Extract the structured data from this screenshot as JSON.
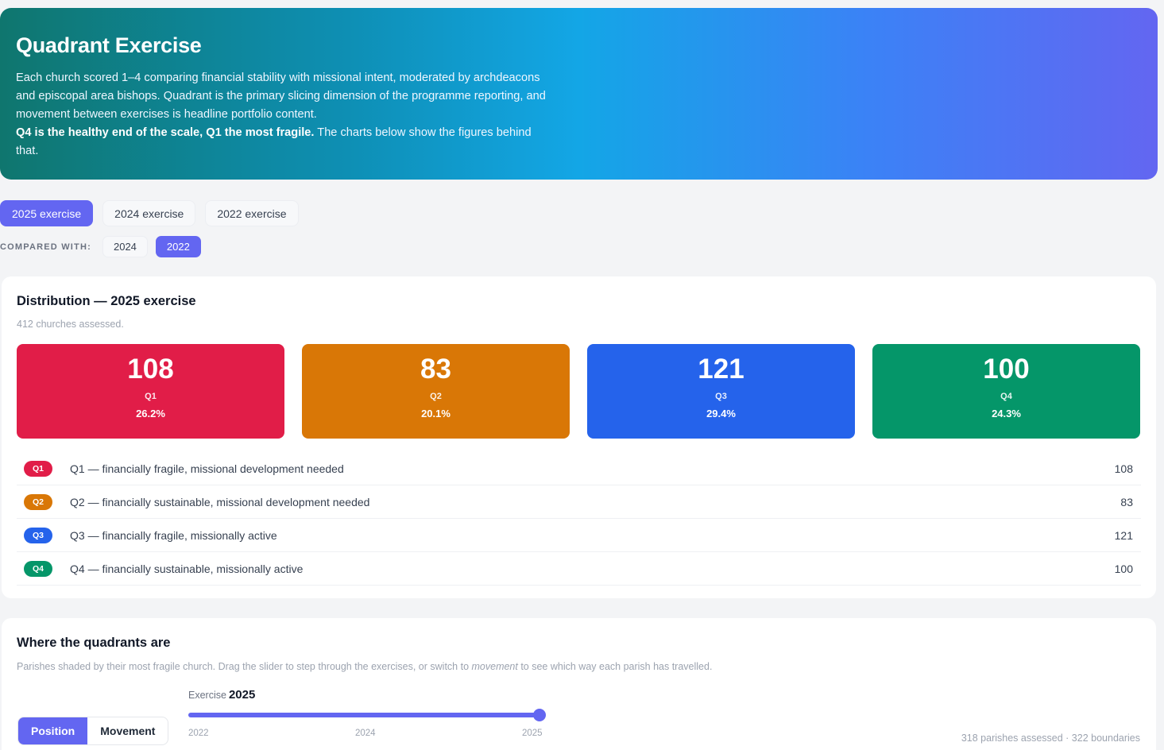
{
  "hero": {
    "title": "Quadrant Exercise",
    "text": "Each church scored 1–4 comparing financial stability with missional intent, moderated by archdeacons and episcopal area bishops. Quadrant is the primary slicing dimension of the programme reporting, and movement between exercises is headline portfolio content.",
    "bold": "Q4 is the healthy end of the scale, Q1 the most fragile.",
    "tail": " The charts below show the figures behind that."
  },
  "tabs": [
    "2025 exercise",
    "2024 exercise",
    "2022 exercise"
  ],
  "compare": {
    "label": "COMPARED WITH:",
    "options": [
      "2024",
      "2022"
    ]
  },
  "distribution": {
    "title": "Distribution — 2025 exercise",
    "subtitle": "412 churches assessed.",
    "tiles": [
      {
        "num": "108",
        "q": "Q1",
        "pct": "26.2%",
        "color": "#e11d48"
      },
      {
        "num": "83",
        "q": "Q2",
        "pct": "20.1%",
        "color": "#d97706"
      },
      {
        "num": "121",
        "q": "Q3",
        "pct": "29.4%",
        "color": "#2563eb"
      },
      {
        "num": "100",
        "q": "Q4",
        "pct": "24.3%",
        "color": "#059669"
      }
    ],
    "legend": [
      {
        "badge": "Q1",
        "label": "Q1 — financially fragile, missional development needed",
        "count": "108"
      },
      {
        "badge": "Q2",
        "label": "Q2 — financially sustainable, missional development needed",
        "count": "83"
      },
      {
        "badge": "Q3",
        "label": "Q3 — financially fragile, missionally active",
        "count": "121"
      },
      {
        "badge": "Q4",
        "label": "Q4 — financially sustainable, missionally active",
        "count": "100"
      }
    ]
  },
  "map": {
    "title": "Where the quadrants are",
    "sub_a": "Parishes shaded by their most fragile church. Drag the slider to step through the exercises, or switch to ",
    "sub_em": "movement",
    "sub_b": " to see which way each parish has travelled.",
    "toggle": [
      "Position",
      "Movement"
    ],
    "slider_label": "Exercise",
    "slider_value": "2025",
    "ticks": [
      "2022",
      "2024",
      "2025"
    ],
    "stats": "318 parishes assessed · 322 boundaries"
  }
}
